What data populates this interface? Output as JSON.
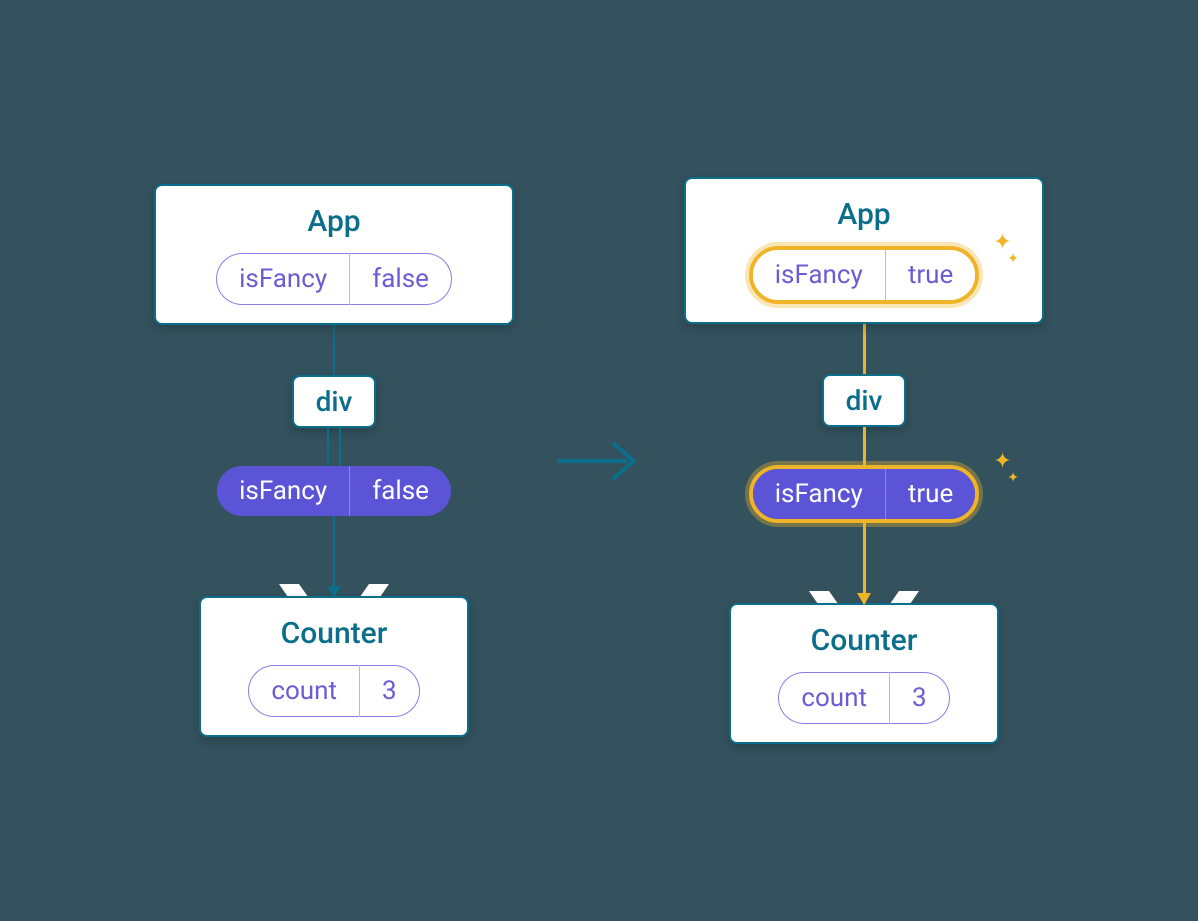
{
  "left": {
    "app": {
      "title": "App",
      "state": {
        "key": "isFancy",
        "value": "false"
      }
    },
    "div": "div",
    "prop": {
      "key": "isFancy",
      "value": "false"
    },
    "counter": {
      "title": "Counter",
      "state": {
        "key": "count",
        "value": "3"
      }
    }
  },
  "right": {
    "app": {
      "title": "App",
      "state": {
        "key": "isFancy",
        "value": "true"
      }
    },
    "div": "div",
    "prop": {
      "key": "isFancy",
      "value": "true"
    },
    "counter": {
      "title": "Counter",
      "state": {
        "key": "count",
        "value": "3"
      }
    }
  }
}
